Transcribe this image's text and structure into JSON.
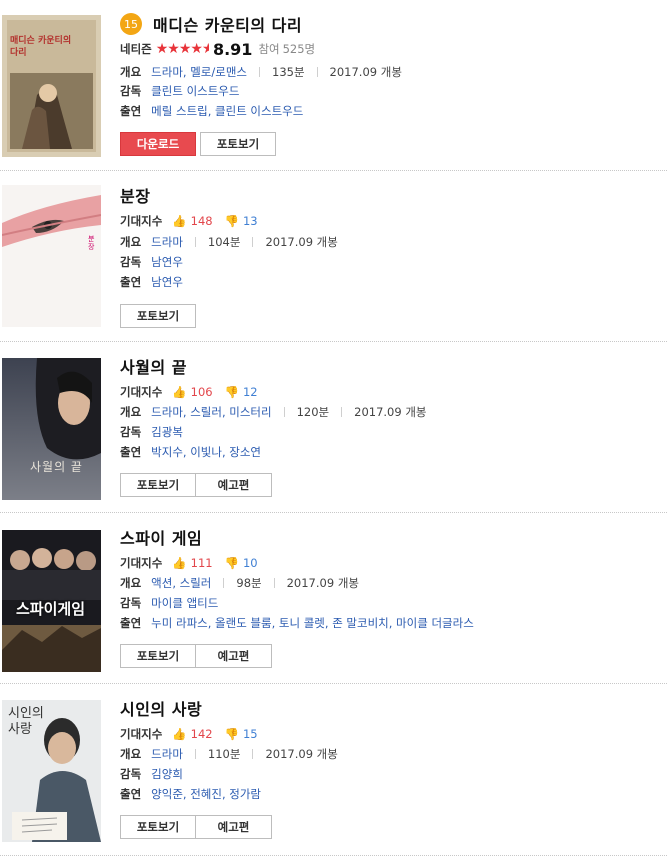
{
  "labels": {
    "netizen": "네티즌",
    "participants_prefix": "참여",
    "expectation": "기대지수",
    "overview": "개요",
    "director": "감독",
    "cast": "출연",
    "download": "다운로드",
    "photos": "포토보기",
    "trailer": "예고편"
  },
  "movies": [
    {
      "rank": "15",
      "title": "매디슨 카운티의 다리",
      "rating_stars": 4.5,
      "rating": "8.91",
      "participants": "525명",
      "genre": "드라마, 멜로/로맨스",
      "runtime": "135분",
      "release": "2017.09 개봉",
      "director": "클린트 이스트우드",
      "cast": "메릴 스트립, 클린트 이스트우드",
      "poster_text": "매디슨 카운티의 다리"
    },
    {
      "title": "분장",
      "likes": "148",
      "dislikes": "13",
      "genre": "드라마",
      "runtime": "104분",
      "release": "2017.09 개봉",
      "director": "남연우",
      "cast": "남연우",
      "poster_text": "분장"
    },
    {
      "title": "사월의 끝",
      "likes": "106",
      "dislikes": "12",
      "genre": "드라마, 스릴러, 미스터리",
      "runtime": "120분",
      "release": "2017.09 개봉",
      "director": "김광복",
      "cast": "박지수, 이빛나, 장소연",
      "poster_text": "사월의 끝"
    },
    {
      "title": "스파이 게임",
      "likes": "111",
      "dislikes": "10",
      "genre": "액션, 스릴러",
      "runtime": "98분",
      "release": "2017.09 개봉",
      "director": "마이클 앱티드",
      "cast": "누미 라파스, 올랜도 블룸, 토니 콜렛, 존 말코비치, 마이클 더글라스",
      "poster_text": "스파이게임"
    },
    {
      "title": "시인의 사랑",
      "likes": "142",
      "dislikes": "15",
      "genre": "드라마",
      "runtime": "110분",
      "release": "2017.09 개봉",
      "director": "김양희",
      "cast": "양익준, 전혜진, 정가람",
      "poster_text": "시인의 사랑"
    }
  ],
  "colors": {
    "accent_red": "#e84a4f",
    "rank_badge": "#f3a614",
    "link_blue": "#2b5bb0",
    "like_red": "#e2464b",
    "dislike_blue": "#3f7fd3"
  }
}
